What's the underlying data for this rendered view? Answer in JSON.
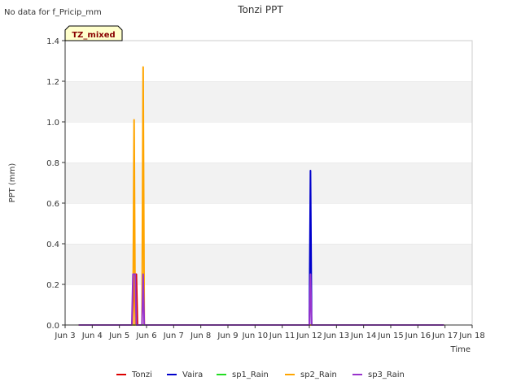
{
  "note": "No data for f_Pricip_mm",
  "badge": "TZ_mixed",
  "chart_data": {
    "type": "line",
    "title": "Tonzi PPT",
    "xlabel": "Time",
    "ylabel": "PPT (mm)",
    "ylim": [
      0,
      1.4
    ],
    "xlim": [
      "2023-06-03",
      "2023-06-18"
    ],
    "x_tick_labels": [
      "Jun 3",
      "Jun 4",
      "Jun 5",
      "Jun 6",
      "Jun 7",
      "Jun 8",
      "Jun 9",
      "Jun 10",
      "Jun 11",
      "Jun 12",
      "Jun 13",
      "Jun 14",
      "Jun 15",
      "Jun 16",
      "Jun 17",
      "Jun 18"
    ],
    "y_ticks": [
      "0.0",
      "0.2",
      "0.4",
      "0.6",
      "0.8",
      "1.0",
      "1.2",
      "1.4"
    ],
    "grid": "horizontal bands",
    "legend_position": "bottom",
    "series": [
      {
        "name": "Tonzi",
        "color": "#dd0000",
        "points": [
          [
            "2023-06-03T12:00",
            0
          ],
          [
            "2023-06-05T12:00",
            0
          ],
          [
            "2023-06-05T13:00",
            0.25
          ],
          [
            "2023-06-05T15:00",
            0.25
          ],
          [
            "2023-06-05T16:00",
            0
          ],
          [
            "2023-06-16T23:00",
            0
          ]
        ]
      },
      {
        "name": "Vaira",
        "color": "#0000cc",
        "points": [
          [
            "2023-06-03T12:00",
            0
          ],
          [
            "2023-06-12T00:00",
            0
          ],
          [
            "2023-06-12T01:00",
            0.76
          ],
          [
            "2023-06-12T02:00",
            0
          ],
          [
            "2023-06-16T23:00",
            0
          ]
        ]
      },
      {
        "name": "sp1_Rain",
        "color": "#22dd22",
        "points": [
          [
            "2023-06-03T12:00",
            0
          ],
          [
            "2023-06-16T23:00",
            0
          ]
        ]
      },
      {
        "name": "sp2_Rain",
        "color": "#ffa500",
        "points": [
          [
            "2023-06-03T12:00",
            0
          ],
          [
            "2023-06-05T12:00",
            0
          ],
          [
            "2023-06-05T13:00",
            1.01
          ],
          [
            "2023-06-05T14:00",
            0
          ],
          [
            "2023-06-05T20:00",
            0
          ],
          [
            "2023-06-05T21:00",
            1.27
          ],
          [
            "2023-06-05T22:00",
            0
          ],
          [
            "2023-06-16T23:00",
            0
          ]
        ]
      },
      {
        "name": "sp3_Rain",
        "color": "#9933cc",
        "points": [
          [
            "2023-06-03T12:00",
            0
          ],
          [
            "2023-06-05T11:00",
            0
          ],
          [
            "2023-06-05T12:00",
            0.25
          ],
          [
            "2023-06-05T14:00",
            0.25
          ],
          [
            "2023-06-05T15:00",
            0
          ],
          [
            "2023-06-05T20:00",
            0
          ],
          [
            "2023-06-05T21:00",
            0.25
          ],
          [
            "2023-06-05T22:00",
            0
          ],
          [
            "2023-06-12T00:00",
            0
          ],
          [
            "2023-06-12T01:00",
            0.25
          ],
          [
            "2023-06-12T02:00",
            0
          ],
          [
            "2023-06-16T23:00",
            0
          ]
        ]
      }
    ]
  }
}
